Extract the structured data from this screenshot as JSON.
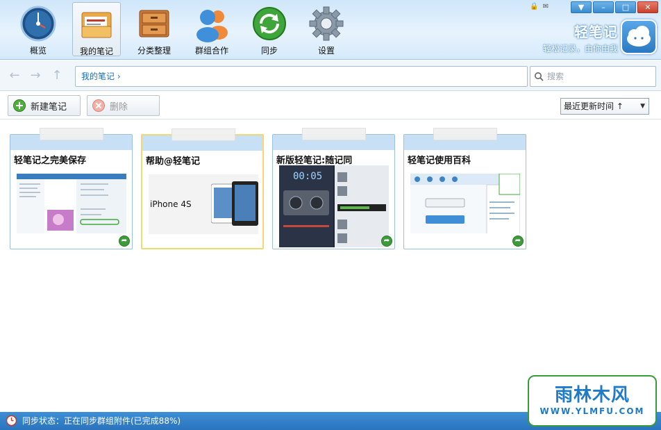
{
  "toolbar": {
    "items": [
      {
        "label": "概览",
        "icon": "overview-gauge-icon"
      },
      {
        "label": "我的笔记",
        "icon": "my-notes-folder-icon"
      },
      {
        "label": "分类整理",
        "icon": "drawer-cabinet-icon"
      },
      {
        "label": "群组合作",
        "icon": "group-users-icon"
      },
      {
        "label": "同步",
        "icon": "sync-arrows-icon"
      },
      {
        "label": "设置",
        "icon": "settings-gear-icon"
      }
    ],
    "active_index": 1
  },
  "brand": {
    "title": "轻笔记",
    "slogan": "轻松记录，由你由我"
  },
  "window_controls": [
    "skin",
    "minimize",
    "maximize",
    "close"
  ],
  "nav": {
    "breadcrumb": "我的笔记 ›",
    "search_placeholder": "搜索"
  },
  "actions": {
    "new_note_label": "新建笔记",
    "delete_label": "删除",
    "sort_value": "最近更新时间 ↑"
  },
  "notes": [
    {
      "title": "轻笔记之完美保存",
      "selected": false
    },
    {
      "title": "帮助@轻笔记",
      "selected": true,
      "thumb_text": "iPhone 4S"
    },
    {
      "title": "新版轻笔记:随记同",
      "selected": false,
      "thumb_text": "00:05"
    },
    {
      "title": "轻笔记使用百科",
      "selected": false
    }
  ],
  "status": {
    "text": "同步状态：正在同步群组附件(已完成88%)"
  },
  "watermark": {
    "big": "雨林木风",
    "small": "WWW.YLMFU.COM"
  },
  "colors": {
    "accent_blue": "#2a73bd",
    "card_border": "#9cc0e0",
    "card_header": "#c8e0f6",
    "selected_border": "#f2d873"
  }
}
